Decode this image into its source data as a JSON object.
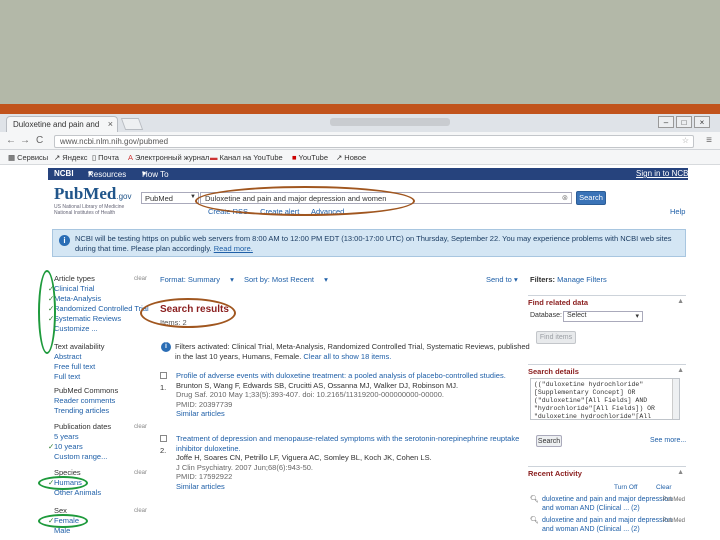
{
  "colors": {
    "slide_bg": "#b3b8a8",
    "slide_accent": "#c1531c",
    "ncbi_blue": "#26437d",
    "oval_brown": "#a0561f",
    "oval_green": "#1e9a3c"
  },
  "browser": {
    "tab_title": "Duloxetine and pain and",
    "url": "www.ncbi.nlm.nih.gov/pubmed",
    "bookmarks": [
      "Сервисы",
      "Яндекс",
      "Почта",
      "Электронный журнал",
      "Канал на YouTube",
      "YouTube",
      "Новое"
    ]
  },
  "ncbi": {
    "brand": "NCBI",
    "resources": "Resources",
    "howto": "How To",
    "signin": "Sign in to NCBI"
  },
  "pubmed": {
    "logo": "PubMed",
    "logo_suffix": ".gov",
    "logo_sub": "US National Library of Medicine National Institutes of Health",
    "db_value": "PubMed",
    "query": "Duloxetine and pain and major depression and women",
    "search_label": "Search",
    "create_rss": "Create RSS",
    "create_alert": "Create alert",
    "advanced": "Advanced",
    "help": "Help"
  },
  "notice": "NCBI will be testing https on public web servers from 8:00 AM to 12:00 PM EDT (13:00-17:00 UTC) on Thursday, September 22. You may experience problems with NCBI web sites during that time. Please plan accordingly.",
  "notice_link": "Read more.",
  "left_filters": {
    "article_types": [
      "Article types",
      "Clinical Trial",
      "Meta-Analysis",
      "Randomized Controlled Trial",
      "Systematic Reviews",
      "Customize ..."
    ],
    "text_availability": [
      "Text availability",
      "Abstract",
      "Free full text",
      "Full text"
    ],
    "pubmed_commons": [
      "PubMed Commons",
      "Reader comments",
      "Trending articles"
    ],
    "publication_dates": [
      "Publication dates",
      "5 years",
      "10 years",
      "Custom range..."
    ],
    "species": [
      "Species",
      "Humans",
      "Other Animals"
    ],
    "sex": [
      "Sex",
      "Female",
      "Male"
    ],
    "clear": "clear"
  },
  "results": {
    "format": "Format: Summary",
    "sort": "Sort by: Most Recent",
    "send_to": "Send to",
    "title": "Search results",
    "items": "Items: 2",
    "filters_msg": "Filters activated: Clinical Trial, Meta-Analysis, Randomized Controlled Trial, Systematic Reviews, published in the last 10 years, Humans, Female.",
    "filters_clear": "Clear all to show 18 items.",
    "list": [
      {
        "number": "1.",
        "title": "Profile of adverse events with duloxetine treatment: a pooled analysis of placebo-controlled studies.",
        "authors": "Brunton S, Wang F, Edwards SB, Crucitti AS, Ossanna MJ, Walker DJ, Robinson MJ.",
        "citation": "Drug Saf. 2010 May 1;33(5):393-407. doi: 10.2165/11319200-000000000-00000.",
        "pmid": "PMID: 20397739",
        "similar": "Similar articles"
      },
      {
        "number": "2.",
        "title": "Treatment of depression and menopause-related symptoms with the serotonin-norepinephrine reuptake inhibitor duloxetine.",
        "authors": "Joffe H, Soares CN, Petrillo LF, Viguera AC, Somley BL, Koch JK, Cohen LS.",
        "citation": "J Clin Psychiatry. 2007 Jun;68(6):943-50.",
        "pmid": "PMID: 17592922",
        "similar": "Similar articles"
      }
    ]
  },
  "right": {
    "filters_label": "Filters:",
    "manage_filters": "Manage Filters",
    "find_related": "Find related data",
    "database_label": "Database:",
    "database_value": "Select",
    "find_items": "Find items",
    "search_details": "Search details",
    "details_text": "((\"duloxetine hydrochloride\"[Supplementary Concept] OR (\"duloxetine\"[All Fields] AND \"hydrochloride\"[All Fields]) OR \"duloxetine hydrochloride\"[All Fields] OR \"duloxetine\"[All Fields]))",
    "search_btn": "Search",
    "see_more": "See more...",
    "recent_activity": "Recent Activity",
    "turn_off": "Turn Off",
    "clear": "Clear",
    "recent": [
      {
        "text": "duloxetine and pain and major depression and woman AND (Clinical ... (2)",
        "db": "PubMed"
      },
      {
        "text": "duloxetine and pain and major depression and woman AND (Clinical ... (2)",
        "db": "PubMed"
      }
    ]
  }
}
